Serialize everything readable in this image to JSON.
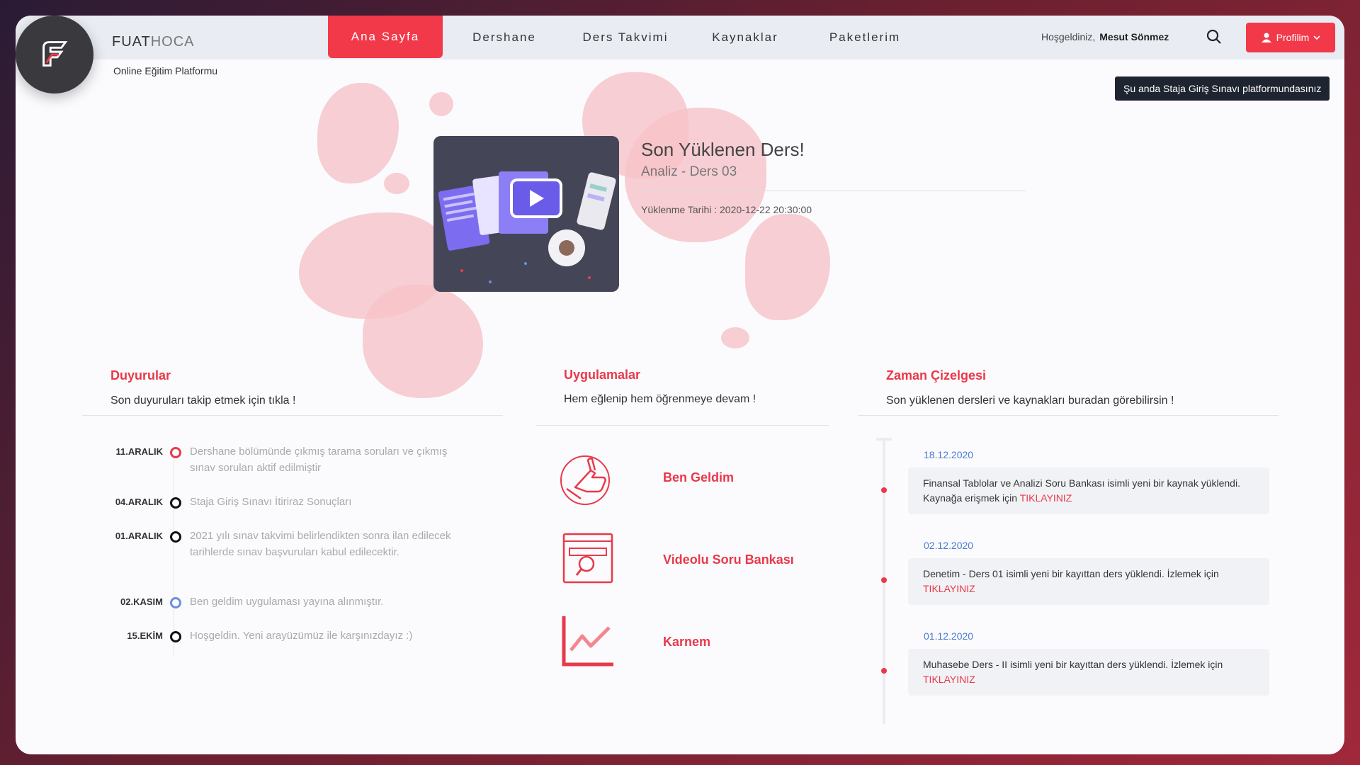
{
  "brand": {
    "name_bold": "FUAT",
    "name_light": "HOCA",
    "subtitle": "Online Eğitim Platformu"
  },
  "nav": {
    "items": [
      {
        "label": "Ana Sayfa",
        "active": true
      },
      {
        "label": "Dershane"
      },
      {
        "label": "Ders Takvimi"
      },
      {
        "label": "Kaynaklar"
      },
      {
        "label": "Paketlerim"
      }
    ]
  },
  "user": {
    "welcome": "Hoşgeldiniz,",
    "name": "Mesut Sönmez",
    "profile_label": "Profilim"
  },
  "tooltip": "Şu anda Staja Giriş Sınavı platformundasınız",
  "hero": {
    "title": "Son Yüklenen Ders!",
    "subtitle": "Analiz - Ders 03",
    "date": "Yüklenme Tarihi : 2020-12-22 20:30:00"
  },
  "announcements": {
    "title": "Duyurular",
    "subtitle": "Son duyuruları takip etmek için tıkla !",
    "items": [
      {
        "date": "11.ARALIK",
        "text": "Dershane bölümünde çıkmış tarama soruları ve çıkmış sınav soruları aktif edilmiştir",
        "dot": "#e8394a"
      },
      {
        "date": "04.ARALIK",
        "text": "Staja Giriş Sınavı İtiriraz Sonuçları",
        "dot": "#111"
      },
      {
        "date": "01.ARALIK",
        "text": "2021 yılı sınav takvimi belirlendikten sonra ilan edilecek tarihlerde sınav başvuruları kabul edilecektir.",
        "dot": "#111"
      },
      {
        "date": "02.KASIM",
        "text": "Ben geldim uygulaması yayına alınmıştır.",
        "dot": "#6a8fe0"
      },
      {
        "date": "15.EKİM",
        "text": "Hoşgeldin. Yeni arayüzümüz ile karşınızdayız :)",
        "dot": "#111"
      }
    ]
  },
  "apps": {
    "title": "Uygulamalar",
    "subtitle": "Hem eğlenip hem öğrenmeye devam !",
    "items": [
      {
        "label": "Ben Geldim",
        "icon": "thumbs-up-icon"
      },
      {
        "label": "Videolu Soru Bankası",
        "icon": "video-search-icon"
      },
      {
        "label": "Karnem",
        "icon": "chart-line-icon"
      }
    ]
  },
  "timeline": {
    "title": "Zaman Çizelgesi",
    "subtitle": "Son yüklenen dersleri ve kaynakları buradan görebilirsin !",
    "items": [
      {
        "date": "18.12.2020",
        "text": "Finansal Tablolar ve Analizi Soru Bankası isimli yeni bir kaynak yüklendi. Kaynağa erişmek için",
        "link": "TIKLAYINIZ"
      },
      {
        "date": "02.12.2020",
        "text": "Denetim - Ders 01 isimli yeni bir kayıttan ders yüklendi. İzlemek için",
        "link": "TIKLAYINIZ"
      },
      {
        "date": "01.12.2020",
        "text": "Muhasebe Ders - II isimli yeni bir kayıttan ders yüklendi. İzlemek için",
        "link": "TIKLAYINIZ"
      }
    ]
  },
  "colors": {
    "accent": "#f2394a",
    "bar": "#eaecf3",
    "blob": "#f6c3c8",
    "link_blue": "#4a7bd0"
  }
}
